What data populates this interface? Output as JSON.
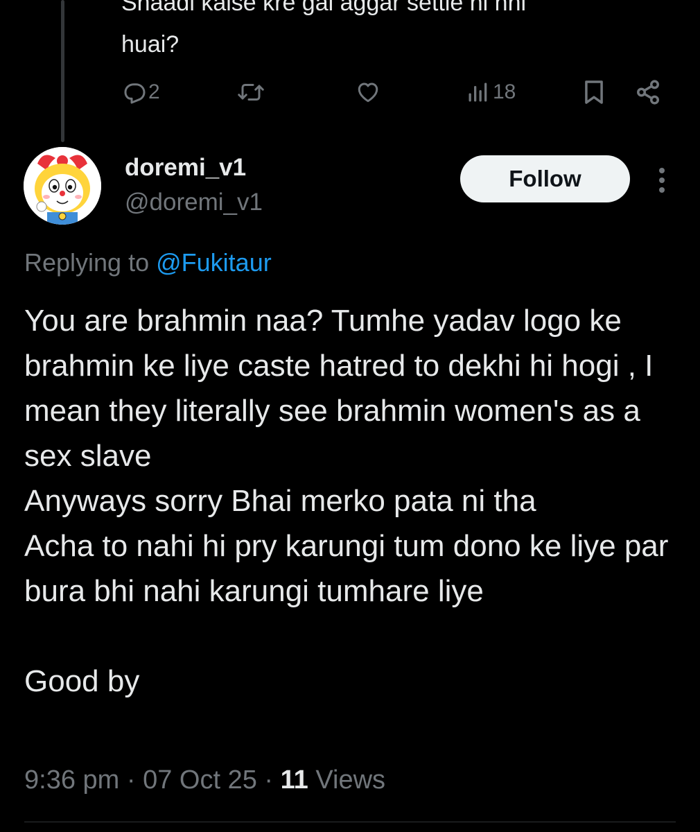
{
  "previous_tweet": {
    "text": "Shaadi kaise kre gai aggar settle hi nhi\nhuai?",
    "actions": {
      "reply_count": "2",
      "retweet_count": "",
      "like_count": "",
      "view_count": "18"
    }
  },
  "tweet": {
    "display_name": "doremi_v1",
    "handle": "@doremi_v1",
    "follow_label": "Follow",
    "replying_prefix": "Replying to",
    "replying_to": "@Fukitaur",
    "text": "You are brahmin naa? Tumhe yadav logo ke brahmin ke liye caste hatred to dekhi hi hogi , I mean they literally see brahmin women's as a sex slave\nAnyways sorry Bhai merko pata ni tha\nAcha to nahi hi pry karungi tum dono ke liye par bura bhi nahi karungi tumhare liye\n\nGood by",
    "time": "9:36 pm",
    "separator": "·",
    "date": "07 Oct 25",
    "views_count": "11",
    "views_label": "Views"
  },
  "icons": {
    "reply": "reply-icon",
    "retweet": "retweet-icon",
    "like": "like-icon",
    "views": "views-icon",
    "bookmark": "bookmark-icon",
    "share": "share-icon",
    "more": "more-options-icon"
  },
  "colors": {
    "background": "#000000",
    "text": "#e7e9ea",
    "muted": "#71767b",
    "link": "#1d9bf0",
    "follow_bg": "#eff3f4",
    "follow_text": "#0f1419"
  }
}
